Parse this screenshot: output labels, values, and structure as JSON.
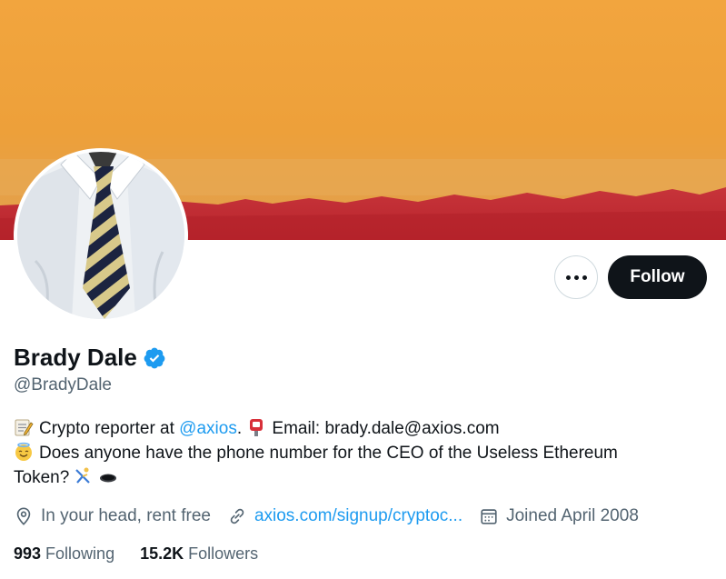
{
  "profile": {
    "display_name": "Brady Dale",
    "handle": "@BradyDale",
    "verified": true,
    "bio": {
      "line1_prefix": "Crypto reporter at ",
      "line1_mention": "@axios",
      "line1_mid": ". ",
      "line1_email": "Email: brady.dale@axios.com",
      "line2": "Does anyone have the phone number for the CEO of the Useless Ethereum",
      "line3": "Token?"
    },
    "location": "In your head, rent free",
    "website": "axios.com/signup/cryptoc...",
    "joined": "Joined April 2008",
    "following_count": "993",
    "following_label": "Following",
    "followers_count": "15.2K",
    "followers_label": "Followers"
  },
  "actions": {
    "follow_label": "Follow"
  },
  "icons": {
    "more": "more-horizontal-icon",
    "verified": "verified-badge-icon",
    "location": "location-pin-icon",
    "link": "link-icon",
    "calendar": "calendar-icon"
  },
  "colors": {
    "accent": "#1d9bf0",
    "follow_button": "#0f1419",
    "secondary_text": "#536471",
    "banner_orange": "#eea038",
    "banner_red": "#c22a2f"
  }
}
